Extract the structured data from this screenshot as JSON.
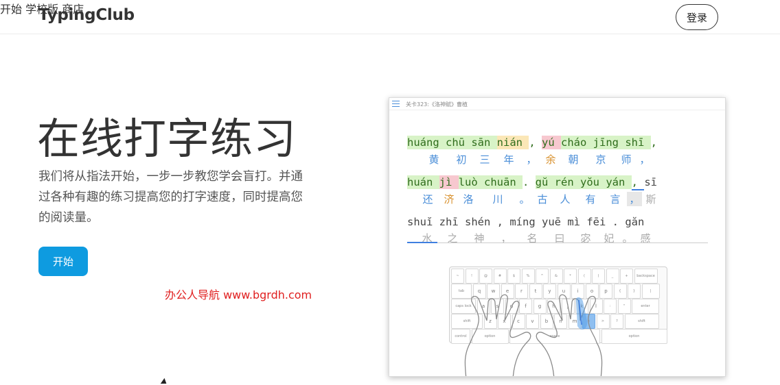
{
  "header": {
    "logo": "TypingClub",
    "nav": [
      "开始",
      "学校版",
      "商店"
    ],
    "login": "登录"
  },
  "hero": {
    "title": "在线打字练习",
    "description": "我们将从指法开始，一步一步教您学会盲打。并通过各种有趣的练习提高您的打字速度，同时提高您的阅读量。",
    "start_button": "开始"
  },
  "watermark": "办公人导航 www.bgrdh.com",
  "card": {
    "level_title": "关卡323:《洛神赋》曹植",
    "lines": [
      {
        "pinyin": [
          "huáng",
          "chū",
          "sān",
          "nián",
          ",",
          "yú",
          "cháo",
          "jīng",
          "shī",
          ","
        ],
        "hanzi": [
          "黄",
          "初",
          "三",
          "年",
          "，",
          "余",
          "朝",
          "京",
          "师",
          "，"
        ]
      },
      {
        "pinyin": [
          "huán",
          "jì",
          "luò",
          "chuān",
          ".",
          "gŭ",
          "rén",
          "yŏu",
          "yán",
          ",",
          "sī"
        ],
        "hanzi": [
          "还",
          "济",
          "洛",
          "川",
          "。",
          "古",
          "人",
          "有",
          "言",
          "，",
          "斯"
        ]
      },
      {
        "pinyin": [
          "shuĭ",
          "zhī",
          "shén",
          ",",
          "míng",
          "yuē",
          "mì",
          "fēi",
          ".",
          "găn"
        ],
        "hanzi": [
          "水",
          "之",
          "神",
          "，",
          "名",
          "曰",
          "宓",
          "妃",
          "。",
          "感"
        ]
      }
    ],
    "keyboard": {
      "row1": [
        "~",
        "!",
        "@",
        "#",
        "$",
        "%",
        "^",
        "&",
        "*",
        "(",
        ")",
        "_",
        "+",
        "backspace"
      ],
      "row2": [
        "tab",
        "q",
        "w",
        "e",
        "r",
        "t",
        "y",
        "u",
        "i",
        "o",
        "p",
        "{",
        "}",
        "|"
      ],
      "row3": [
        "caps lock",
        "a",
        "s",
        "d",
        "f",
        "g",
        "h",
        "j",
        "k",
        "l",
        ":",
        "\"",
        "enter"
      ],
      "row4": [
        "shift",
        "z",
        "x",
        "c",
        "v",
        "b",
        "n",
        "m",
        "<",
        ">",
        "?",
        "shift"
      ],
      "row5": [
        "control",
        "option",
        "space",
        "option"
      ]
    }
  },
  "colors": {
    "accent": "#0e9be0",
    "pinyin_correct_bg": "#d8f3c7",
    "pinyin_error_bg": "#f7c8cf",
    "hanzi_blue": "#4a8ed8",
    "watermark_red": "#e02020"
  }
}
